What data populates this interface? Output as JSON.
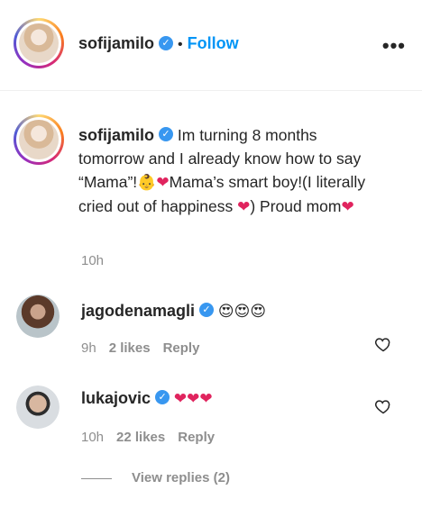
{
  "post": {
    "author": "sofijamilo",
    "dot": "•",
    "follow_label": "Follow",
    "more_icon": "more-horizontal-icon",
    "more_label": "•••"
  },
  "caption": {
    "author": "sofijamilo",
    "text_1": "Im turning 8 months tomorrow and I already know how to say “Mama”!",
    "emoji_baby": "👶",
    "emoji_heart_1": "❤",
    "text_2": "Mama’s smart boy!(I literally cried out of happiness ",
    "emoji_heart_2": "❤",
    "text_3": ") Proud mom",
    "emoji_heart_3": "❤",
    "time": "10h"
  },
  "comments": [
    {
      "author": "jagodenamagli",
      "emojis": "😍😍😍",
      "time": "9h",
      "likes": "2 likes",
      "reply": "Reply"
    },
    {
      "author": "lukajovic",
      "emojis": "❤❤❤",
      "time": "10h",
      "likes": "22 likes",
      "reply": "Reply"
    }
  ],
  "view_replies": "View replies (2)",
  "colors": {
    "link": "#0095f6",
    "verified": "#3897f0",
    "muted": "#8e8e8e",
    "heart": "#e0245e"
  }
}
